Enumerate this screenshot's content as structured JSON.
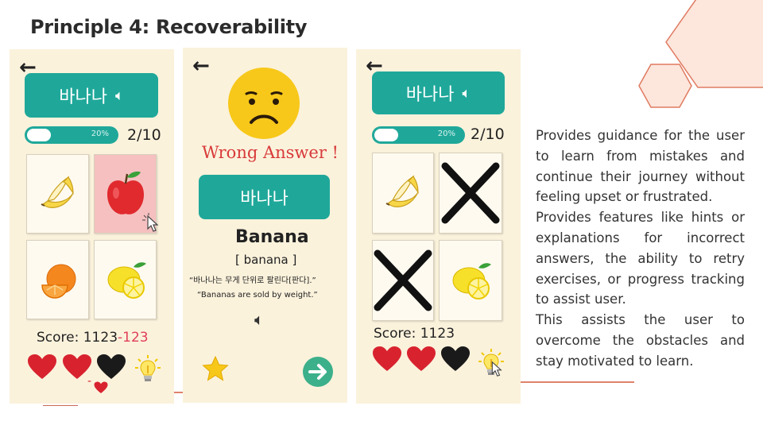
{
  "slide_title": "Principle 4: Recoverability",
  "screen1": {
    "word_button": "바나나",
    "progress_percent": 20,
    "progress_label": "20%",
    "counter": "2/10",
    "score_label": "Score: 1123",
    "score_penalty": "-123",
    "cards": [
      "banana",
      "apple",
      "orange",
      "lemon"
    ],
    "lives_remaining": 2,
    "lives_total": 3
  },
  "screen2": {
    "feedback_title": "Wrong Answer !",
    "word_button": "바나나",
    "english_word": "Banana",
    "phonetic": "[ banana ]",
    "example_korean": "“바나나는 무게 단위로 팔린다[판다].”",
    "example_english": "“Bananas are sold by weight.”"
  },
  "screen3": {
    "word_button": "바나나",
    "progress_percent": 20,
    "progress_label": "20%",
    "counter": "2/10",
    "score_label": "Score: 1123",
    "cards": [
      "banana",
      "eliminated",
      "eliminated",
      "lemon"
    ],
    "lives_remaining": 2,
    "lives_total": 3
  },
  "description": [
    "Provides guidance for the user to learn from mistakes and continue their journey without feeling upset or frustrated.",
    "Provides features like hints or explanations for incorrect answers, the ability to retry exercises, or progress tracking to assist user.",
    "This assists the user to overcome the obstacles and stay motivated to learn."
  ],
  "colors": {
    "teal": "#1fa89a",
    "cream": "#fbf2dc",
    "heart_red": "#d8232f",
    "heart_black": "#1a1a1a",
    "error_red": "#d83a3a",
    "accent_orange": "#e0826a"
  }
}
